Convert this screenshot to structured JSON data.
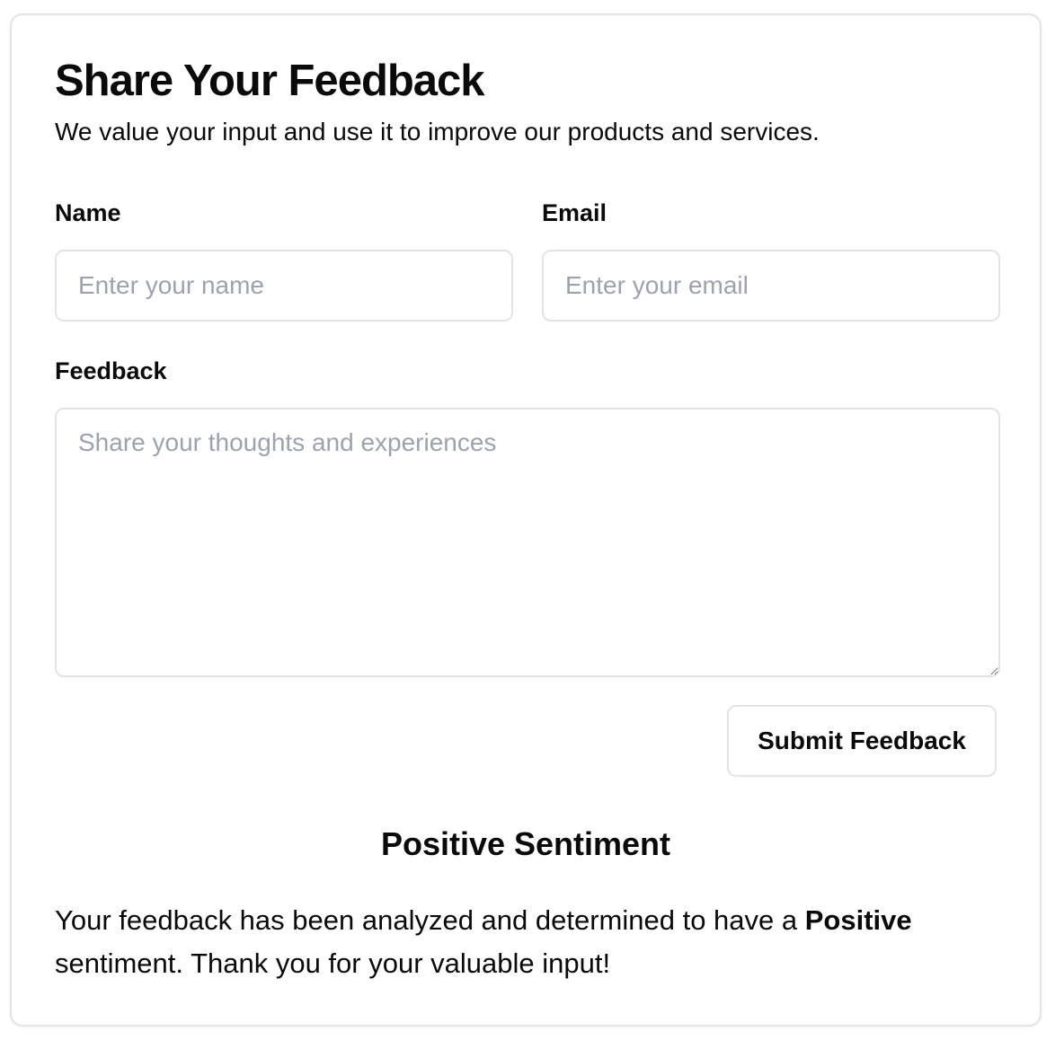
{
  "form": {
    "title": "Share Your Feedback",
    "subtitle": "We value your input and use it to improve our products and services.",
    "name_label": "Name",
    "name_placeholder": "Enter your name",
    "name_value": "",
    "email_label": "Email",
    "email_placeholder": "Enter your email",
    "email_value": "",
    "feedback_label": "Feedback",
    "feedback_placeholder": "Share your thoughts and experiences",
    "feedback_value": "",
    "submit_label": "Submit Feedback"
  },
  "result": {
    "title": "Positive Sentiment",
    "text_before": "Your feedback has been analyzed and determined to have a ",
    "sentiment": "Positive",
    "text_after": " sentiment. Thank you for your valuable input!"
  }
}
